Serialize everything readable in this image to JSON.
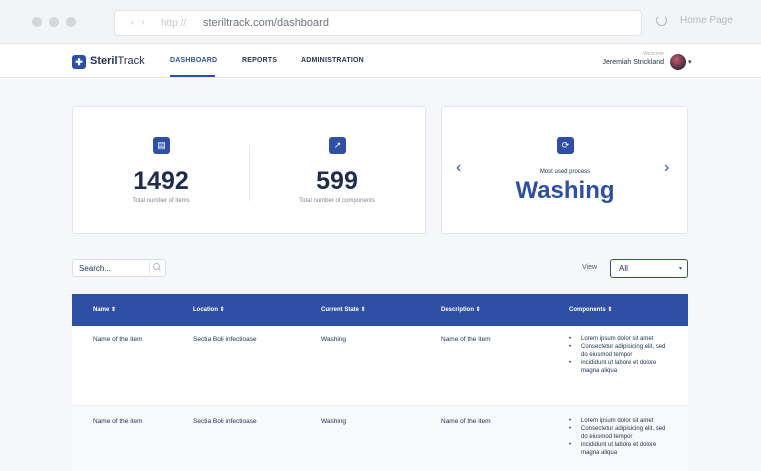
{
  "browser": {
    "nav_arrows": "‹ ›",
    "protocol": "http://",
    "url": "steriltrack.com/dashboard",
    "home_label": "Home Page"
  },
  "app": {
    "logo_text_bold": "Steril",
    "logo_text_light": "Track",
    "nav": [
      "DASHBOARD",
      "REPORTS",
      "ADMINISTRATION"
    ],
    "active_nav": "DASHBOARD",
    "welcome": "Welcome",
    "user_name": "Jeremiah Strickland"
  },
  "stats": [
    {
      "icon": "box-icon",
      "value": "1492",
      "label": "Total number of items"
    },
    {
      "icon": "trend-icon",
      "value": "599",
      "label": "Total number of components"
    }
  ],
  "process": {
    "icon": "refresh-icon",
    "subtitle": "Most used process",
    "name": "Washing"
  },
  "search": {
    "placeholder": "Search..."
  },
  "view": {
    "label": "View",
    "selected": "All"
  },
  "table": {
    "headers": [
      "Name ⇕",
      "Location ⇕",
      "Current State ⇕",
      "Description ⇕",
      "Components ⇕"
    ],
    "rows": [
      {
        "name": "Name of the item",
        "location": "Sectia Boli infectioase",
        "state": "Washing",
        "description": "Name of the item",
        "components": [
          "Lorem ipsum dolor sit amet",
          "Consectetur adipisicing elit, sed do eiusmod tempor",
          "incididunt ut labore et dolore magna aliqua"
        ]
      },
      {
        "name": "Name of the item",
        "location": "Sectia Boli infectioase",
        "state": "Washing",
        "description": "Name of the item",
        "components": [
          "Lorem ipsum dolor sit amet",
          "Consectetur adipisicing elit, sed do eiusmod tempor",
          "incididunt ut labore et dolore magna aliqua"
        ]
      }
    ]
  },
  "colors": {
    "primary": "#2e4fa3",
    "text": "#1f2d4d",
    "background": "#f5f7fa"
  }
}
